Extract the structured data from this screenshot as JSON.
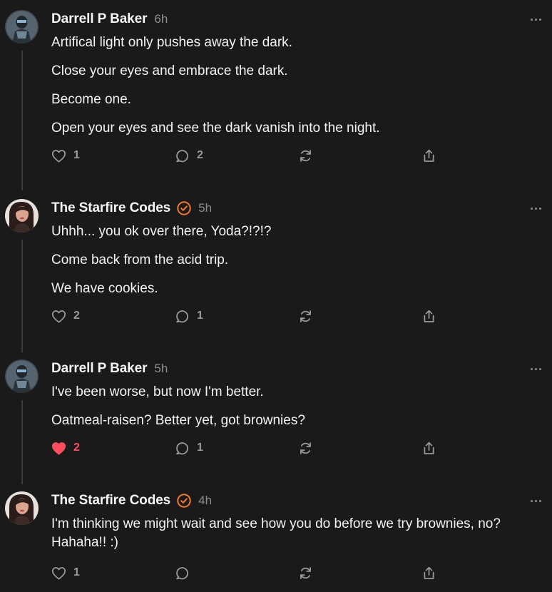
{
  "colors": {
    "background": "#1a1a1a",
    "liked": "#ff4d5e",
    "verified": "#f47a2a",
    "muted": "#8e8e8e"
  },
  "posts": [
    {
      "author": "Darrell P Baker",
      "verified": false,
      "time": "6h",
      "avatar_icon": "helmet-avatar-icon",
      "lines": [
        "Artifical light only pushes away the dark.",
        "Close your eyes and embrace the dark.",
        "Become one.",
        "Open your eyes and see the dark vanish into the night."
      ],
      "likes": "1",
      "liked": false,
      "replies": "2"
    },
    {
      "author": "The Starfire Codes",
      "verified": true,
      "time": "5h",
      "avatar_icon": "woman-avatar-icon",
      "lines": [
        "Uhhh... you ok over there, Yoda?!?!?",
        "Come back from the acid trip.",
        "We have cookies."
      ],
      "likes": "2",
      "liked": false,
      "replies": "1"
    },
    {
      "author": "Darrell P Baker",
      "verified": false,
      "time": "5h",
      "avatar_icon": "helmet-avatar-icon",
      "lines": [
        "I've been worse, but now I'm better.",
        "Oatmeal-raisen? Better yet, got brownies?"
      ],
      "likes": "2",
      "liked": true,
      "replies": "1"
    },
    {
      "author": "The Starfire Codes",
      "verified": true,
      "time": "4h",
      "avatar_icon": "woman-avatar-icon",
      "lines": [
        "I'm thinking we might wait and see how you do before we try brownies, no?",
        "Hahaha!! :)"
      ],
      "likes": "1",
      "liked": false,
      "replies": ""
    }
  ]
}
